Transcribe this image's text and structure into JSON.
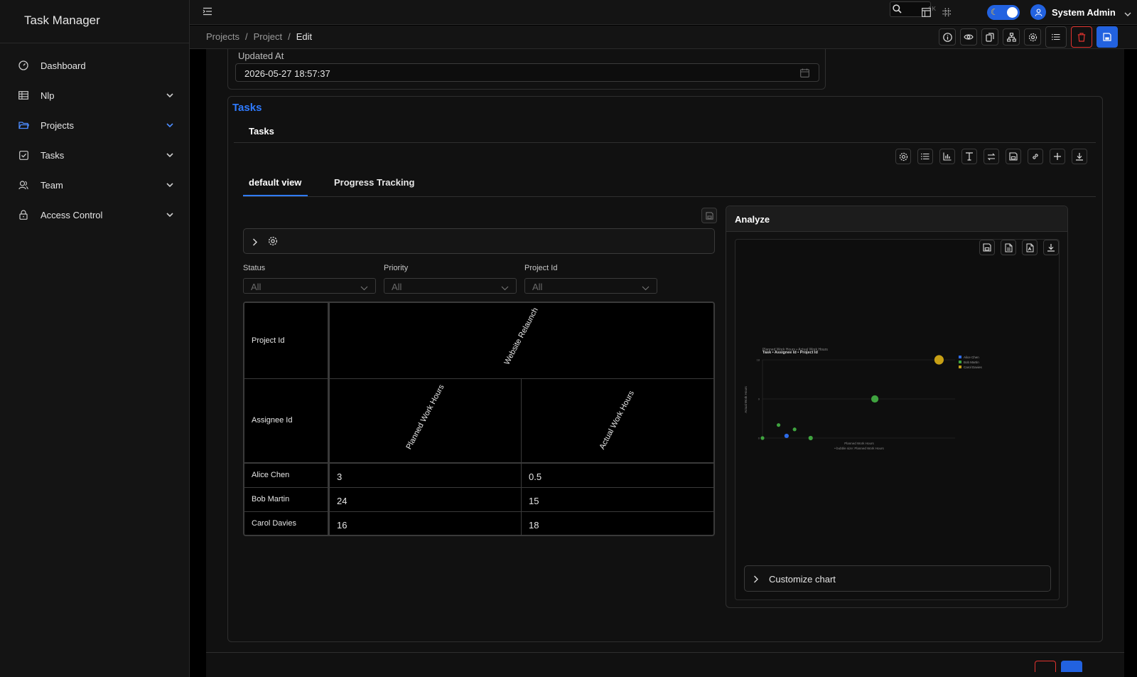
{
  "app": {
    "title": "Task Manager"
  },
  "sidebar": {
    "items": [
      {
        "label": "Dashboard",
        "icon": "dashboard-icon",
        "expandable": false
      },
      {
        "label": "Nlp",
        "icon": "table-icon",
        "expandable": true
      },
      {
        "label": "Projects",
        "icon": "folder-icon",
        "expandable": true,
        "active": true
      },
      {
        "label": "Tasks",
        "icon": "checkbox-icon",
        "expandable": true
      },
      {
        "label": "Team",
        "icon": "team-icon",
        "expandable": true
      },
      {
        "label": "Access Control",
        "icon": "lock-icon",
        "expandable": true
      }
    ]
  },
  "topbar": {
    "search_shortcut": "⌃K",
    "user_name": "System Admin"
  },
  "breadcrumb": {
    "items": [
      "Projects",
      "Project",
      "Edit"
    ],
    "separator": "/"
  },
  "form": {
    "updated_at_label": "Updated At",
    "updated_at_value": "2026-05-27 18:57:37"
  },
  "tasks": {
    "section_title": "Tasks",
    "subtitle": "Tasks",
    "tabs": [
      "default view",
      "Progress Tracking"
    ],
    "filters": [
      {
        "label": "Status",
        "value": "All"
      },
      {
        "label": "Priority",
        "value": "All"
      },
      {
        "label": "Project Id",
        "value": "All"
      }
    ],
    "pivot": {
      "row_header_1": "Project Id",
      "row_header_2": "Assignee Id",
      "project": "Website Relaunch",
      "measures": [
        "Planned Work Hours",
        "Actual Work Hours"
      ],
      "rows": [
        {
          "assignee": "Alice Chen",
          "planned": "3",
          "actual": "0.5"
        },
        {
          "assignee": "Bob Martin",
          "planned": "24",
          "actual": "15"
        },
        {
          "assignee": "Carol Davies",
          "planned": "16",
          "actual": "18"
        }
      ]
    }
  },
  "analyze": {
    "title": "Analyze",
    "customize_label": "Customize chart"
  },
  "chart_data": {
    "type": "scatter",
    "title": "Task • Assignee Id • Project Id",
    "subtitle": "Planned Work Hours • Actual Work Hours",
    "xlabel": "Planned Work Hours",
    "ylabel": "Actual Work Hours",
    "size_note": "• bubble size: Planned Work Hours",
    "y_ticks": [
      0,
      9,
      18
    ],
    "xlim": [
      0,
      24
    ],
    "ylim": [
      0,
      18
    ],
    "legend_position": "top-right",
    "series": [
      {
        "name": "Alice Chen",
        "color": "#2d6be8",
        "points": [
          {
            "x": 3,
            "y": 0.5,
            "size": 3
          }
        ]
      },
      {
        "name": "Bob Martin",
        "color": "#3fa33f",
        "points": [
          {
            "x": 0,
            "y": 0,
            "size": 2
          },
          {
            "x": 2,
            "y": 3,
            "size": 2
          },
          {
            "x": 4,
            "y": 2,
            "size": 2
          },
          {
            "x": 6,
            "y": 0,
            "size": 3
          },
          {
            "x": 14,
            "y": 9,
            "size": 7
          }
        ]
      },
      {
        "name": "Carol Davies",
        "color": "#c8a015",
        "points": [
          {
            "x": 22,
            "y": 18,
            "size": 10
          }
        ]
      }
    ]
  },
  "colors": {
    "accent": "#2f7bff",
    "danger": "#e0332f",
    "primary": "#2262e0"
  }
}
